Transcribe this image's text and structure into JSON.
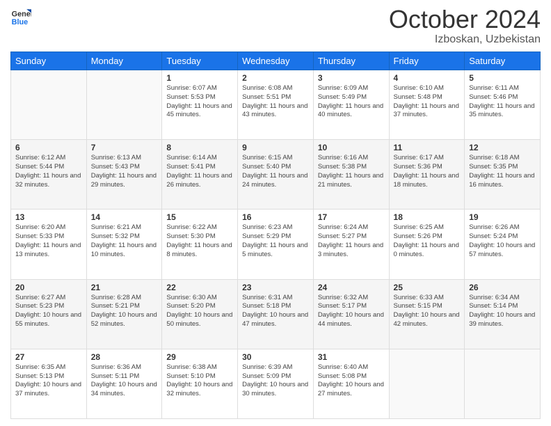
{
  "logo": {
    "line1": "General",
    "line2": "Blue"
  },
  "title": "October 2024",
  "location": "Izboskan, Uzbekistan",
  "days_header": [
    "Sunday",
    "Monday",
    "Tuesday",
    "Wednesday",
    "Thursday",
    "Friday",
    "Saturday"
  ],
  "weeks": [
    [
      {
        "num": "",
        "detail": ""
      },
      {
        "num": "",
        "detail": ""
      },
      {
        "num": "1",
        "detail": "Sunrise: 6:07 AM\nSunset: 5:53 PM\nDaylight: 11 hours and 45 minutes."
      },
      {
        "num": "2",
        "detail": "Sunrise: 6:08 AM\nSunset: 5:51 PM\nDaylight: 11 hours and 43 minutes."
      },
      {
        "num": "3",
        "detail": "Sunrise: 6:09 AM\nSunset: 5:49 PM\nDaylight: 11 hours and 40 minutes."
      },
      {
        "num": "4",
        "detail": "Sunrise: 6:10 AM\nSunset: 5:48 PM\nDaylight: 11 hours and 37 minutes."
      },
      {
        "num": "5",
        "detail": "Sunrise: 6:11 AM\nSunset: 5:46 PM\nDaylight: 11 hours and 35 minutes."
      }
    ],
    [
      {
        "num": "6",
        "detail": "Sunrise: 6:12 AM\nSunset: 5:44 PM\nDaylight: 11 hours and 32 minutes."
      },
      {
        "num": "7",
        "detail": "Sunrise: 6:13 AM\nSunset: 5:43 PM\nDaylight: 11 hours and 29 minutes."
      },
      {
        "num": "8",
        "detail": "Sunrise: 6:14 AM\nSunset: 5:41 PM\nDaylight: 11 hours and 26 minutes."
      },
      {
        "num": "9",
        "detail": "Sunrise: 6:15 AM\nSunset: 5:40 PM\nDaylight: 11 hours and 24 minutes."
      },
      {
        "num": "10",
        "detail": "Sunrise: 6:16 AM\nSunset: 5:38 PM\nDaylight: 11 hours and 21 minutes."
      },
      {
        "num": "11",
        "detail": "Sunrise: 6:17 AM\nSunset: 5:36 PM\nDaylight: 11 hours and 18 minutes."
      },
      {
        "num": "12",
        "detail": "Sunrise: 6:18 AM\nSunset: 5:35 PM\nDaylight: 11 hours and 16 minutes."
      }
    ],
    [
      {
        "num": "13",
        "detail": "Sunrise: 6:20 AM\nSunset: 5:33 PM\nDaylight: 11 hours and 13 minutes."
      },
      {
        "num": "14",
        "detail": "Sunrise: 6:21 AM\nSunset: 5:32 PM\nDaylight: 11 hours and 10 minutes."
      },
      {
        "num": "15",
        "detail": "Sunrise: 6:22 AM\nSunset: 5:30 PM\nDaylight: 11 hours and 8 minutes."
      },
      {
        "num": "16",
        "detail": "Sunrise: 6:23 AM\nSunset: 5:29 PM\nDaylight: 11 hours and 5 minutes."
      },
      {
        "num": "17",
        "detail": "Sunrise: 6:24 AM\nSunset: 5:27 PM\nDaylight: 11 hours and 3 minutes."
      },
      {
        "num": "18",
        "detail": "Sunrise: 6:25 AM\nSunset: 5:26 PM\nDaylight: 11 hours and 0 minutes."
      },
      {
        "num": "19",
        "detail": "Sunrise: 6:26 AM\nSunset: 5:24 PM\nDaylight: 10 hours and 57 minutes."
      }
    ],
    [
      {
        "num": "20",
        "detail": "Sunrise: 6:27 AM\nSunset: 5:23 PM\nDaylight: 10 hours and 55 minutes."
      },
      {
        "num": "21",
        "detail": "Sunrise: 6:28 AM\nSunset: 5:21 PM\nDaylight: 10 hours and 52 minutes."
      },
      {
        "num": "22",
        "detail": "Sunrise: 6:30 AM\nSunset: 5:20 PM\nDaylight: 10 hours and 50 minutes."
      },
      {
        "num": "23",
        "detail": "Sunrise: 6:31 AM\nSunset: 5:18 PM\nDaylight: 10 hours and 47 minutes."
      },
      {
        "num": "24",
        "detail": "Sunrise: 6:32 AM\nSunset: 5:17 PM\nDaylight: 10 hours and 44 minutes."
      },
      {
        "num": "25",
        "detail": "Sunrise: 6:33 AM\nSunset: 5:15 PM\nDaylight: 10 hours and 42 minutes."
      },
      {
        "num": "26",
        "detail": "Sunrise: 6:34 AM\nSunset: 5:14 PM\nDaylight: 10 hours and 39 minutes."
      }
    ],
    [
      {
        "num": "27",
        "detail": "Sunrise: 6:35 AM\nSunset: 5:13 PM\nDaylight: 10 hours and 37 minutes."
      },
      {
        "num": "28",
        "detail": "Sunrise: 6:36 AM\nSunset: 5:11 PM\nDaylight: 10 hours and 34 minutes."
      },
      {
        "num": "29",
        "detail": "Sunrise: 6:38 AM\nSunset: 5:10 PM\nDaylight: 10 hours and 32 minutes."
      },
      {
        "num": "30",
        "detail": "Sunrise: 6:39 AM\nSunset: 5:09 PM\nDaylight: 10 hours and 30 minutes."
      },
      {
        "num": "31",
        "detail": "Sunrise: 6:40 AM\nSunset: 5:08 PM\nDaylight: 10 hours and 27 minutes."
      },
      {
        "num": "",
        "detail": ""
      },
      {
        "num": "",
        "detail": ""
      }
    ]
  ]
}
